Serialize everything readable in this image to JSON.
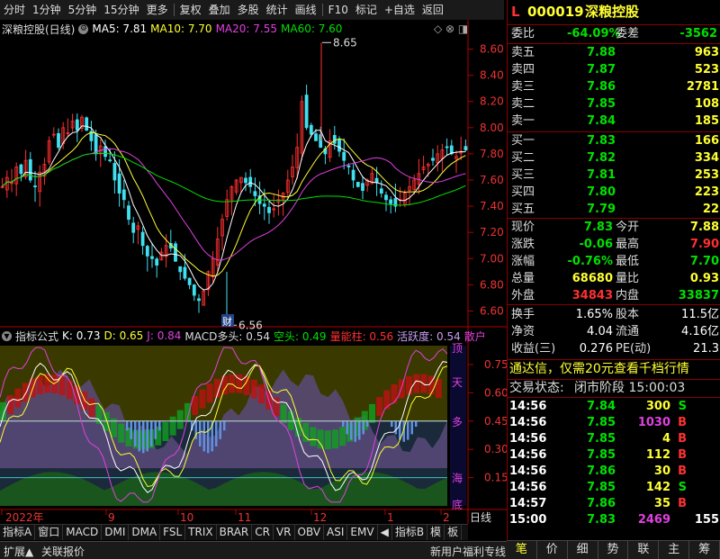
{
  "toolbar": {
    "items": [
      "分时",
      "1分钟",
      "5分钟",
      "15分钟",
      "更多",
      "复权",
      "叠加",
      "多股",
      "统计",
      "画线",
      "F10",
      "标记",
      "+自选",
      "返回"
    ]
  },
  "stock": {
    "code": "000019",
    "name": "深粮控股",
    "title": "深粮控股(日线)",
    "flag": "L"
  },
  "main_info": {
    "ma5": "MA5: 7.81",
    "ma10": "MA10: 7.70",
    "ma20": "MA20: 7.55",
    "ma60": "MA60: 7.60",
    "colors": {
      "ma5": "#ffffff",
      "ma10": "#ffff33",
      "ma20": "#e040e0",
      "ma60": "#00e000"
    }
  },
  "price_axis": [
    "8.60",
    "8.40",
    "8.20",
    "8.00",
    "7.80",
    "7.60",
    "7.40",
    "7.20",
    "7.00",
    "6.80",
    "6.60"
  ],
  "annotations": {
    "high": "8.65",
    "low": "6.56",
    "cai": "财"
  },
  "ind_info": {
    "name": "指标公式",
    "k": "K: 0.73",
    "d": "D: 0.65",
    "j": "J: 0.84",
    "macd": "MACD多头: 0.54",
    "kong": "空头: 0.49",
    "liang": "量能柱: 0.56",
    "huo": "活跃度: 0.54",
    "san": "散户"
  },
  "ind_axis": [
    "0.75",
    "0.60",
    "0.45",
    "0.30",
    "0.15"
  ],
  "ind_zone_labels": [
    "顶",
    "天",
    "多",
    "海",
    "底"
  ],
  "time_axis": {
    "labels": [
      "2022年",
      "9",
      "10",
      "11",
      "12",
      "1",
      "2"
    ],
    "period": "日线"
  },
  "ind_tabs": [
    "指标A",
    "窗口",
    "MACD",
    "DMI",
    "DMA",
    "FSL",
    "TRIX",
    "BRAR",
    "CR",
    "VR",
    "OBV",
    "ASI",
    "EMV",
    "◀",
    "指标B",
    "模",
    "板"
  ],
  "status_bar": {
    "left1": "扩展▲",
    "left2": "关联报价",
    "right": "新用户福利专线"
  },
  "quote": {
    "weibi": {
      "label": "委比",
      "value": "-64.09%",
      "label2": "委差",
      "value2": "-3562"
    },
    "asks": [
      {
        "label": "卖五",
        "price": "7.88",
        "vol": "963"
      },
      {
        "label": "卖四",
        "price": "7.87",
        "vol": "523"
      },
      {
        "label": "卖三",
        "price": "7.86",
        "vol": "2781"
      },
      {
        "label": "卖二",
        "price": "7.85",
        "vol": "108"
      },
      {
        "label": "卖一",
        "price": "7.84",
        "vol": "185"
      }
    ],
    "bids": [
      {
        "label": "买一",
        "price": "7.83",
        "vol": "166"
      },
      {
        "label": "买二",
        "price": "7.82",
        "vol": "334"
      },
      {
        "label": "买三",
        "price": "7.81",
        "vol": "253"
      },
      {
        "label": "买四",
        "price": "7.80",
        "vol": "223"
      },
      {
        "label": "买五",
        "price": "7.79",
        "vol": "22"
      }
    ],
    "stats": [
      {
        "l1": "现价",
        "v1": "7.83",
        "l2": "今开",
        "v2": "7.88"
      },
      {
        "l1": "涨跌",
        "v1": "-0.06",
        "l2": "最高",
        "v2": "7.90"
      },
      {
        "l1": "涨幅",
        "v1": "-0.76%",
        "l2": "最低",
        "v2": "7.70"
      },
      {
        "l1": "总量",
        "v1": "68680",
        "l2": "量比",
        "v2": "0.93"
      },
      {
        "l1": "外盘",
        "v1": "34843",
        "l2": "内盘",
        "v2": "33837"
      }
    ],
    "stats2": [
      {
        "l1": "换手",
        "v1": "1.65%",
        "l2": "股本",
        "v2": "11.5亿"
      },
      {
        "l1": "净资",
        "v1": "4.04",
        "l2": "流通",
        "v2": "4.16亿"
      },
      {
        "l1": "收益(三)",
        "v1": "0.276",
        "l2": "PE(动)",
        "v2": "21.3"
      }
    ],
    "promo": "通达信，仅需20元查看千档行情",
    "trade_state": {
      "label": "交易状态:",
      "value": "闭市阶段 15:00:03"
    },
    "ticks": [
      {
        "t": "14:56",
        "p": "7.84",
        "v": "300",
        "s": "S"
      },
      {
        "t": "14:56",
        "p": "7.85",
        "v": "1030",
        "s": "B"
      },
      {
        "t": "14:56",
        "p": "7.85",
        "v": "4",
        "s": "B"
      },
      {
        "t": "14:56",
        "p": "7.85",
        "v": "112",
        "s": "B"
      },
      {
        "t": "14:56",
        "p": "7.86",
        "v": "30",
        "s": "B"
      },
      {
        "t": "14:56",
        "p": "7.85",
        "v": "142",
        "s": "S"
      },
      {
        "t": "14:57",
        "p": "7.86",
        "v": "35",
        "s": "B"
      },
      {
        "t": "15:00",
        "p": "7.83",
        "v": "2469",
        "s": "155"
      }
    ],
    "tabs": [
      "笔",
      "价",
      "细",
      "势",
      "联",
      "主",
      "筹"
    ]
  },
  "chart_data": {
    "type": "candlestick",
    "ylim": [
      6.5,
      8.7
    ],
    "ma": {
      "MA5": 7.81,
      "MA10": 7.7,
      "MA20": 7.55,
      "MA60": 7.6
    },
    "high": 8.65,
    "low": 6.56
  }
}
